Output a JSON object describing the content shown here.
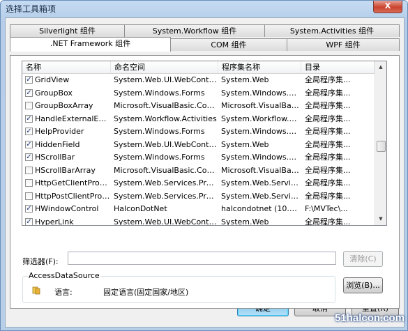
{
  "window": {
    "title": "选择工具箱项",
    "close_glyph": "X"
  },
  "tabs": {
    "row1": [
      {
        "label": "Silverlight 组件"
      },
      {
        "label": "System.Workflow 组件"
      },
      {
        "label": "System.Activities 组件"
      }
    ],
    "row2": [
      {
        "label": ".NET Framework 组件",
        "active": true
      },
      {
        "label": "COM 组件"
      },
      {
        "label": "WPF 组件"
      }
    ]
  },
  "list": {
    "columns": [
      "名称",
      "命名空间",
      "程序集名称",
      "目录"
    ],
    "check_glyph": "✓",
    "rows": [
      {
        "checked": true,
        "name": "GridView",
        "namespace": "System.Web.UI.WebContr...",
        "assembly": "System.Web",
        "directory": "全局程序集..."
      },
      {
        "checked": true,
        "name": "GroupBox",
        "namespace": "System.Windows.Forms",
        "assembly": "System.Windows.Fo...",
        "directory": "全局程序集..."
      },
      {
        "checked": false,
        "name": "GroupBoxArray",
        "namespace": "Microsoft.VisualBasic.Com...",
        "assembly": "Microsoft.VisualBas...",
        "directory": "全局程序集..."
      },
      {
        "checked": true,
        "name": "HandleExternalEvent",
        "namespace": "System.Workflow.Activities",
        "assembly": "System.Workflow.A...",
        "directory": "全局程序集..."
      },
      {
        "checked": true,
        "name": "HelpProvider",
        "namespace": "System.Windows.Forms",
        "assembly": "System.Windows.Fo...",
        "directory": "全局程序集..."
      },
      {
        "checked": true,
        "name": "HiddenField",
        "namespace": "System.Web.UI.WebContr...",
        "assembly": "System.Web",
        "directory": "全局程序集..."
      },
      {
        "checked": true,
        "name": "HScrollBar",
        "namespace": "System.Windows.Forms",
        "assembly": "System.Windows.Fo...",
        "directory": "全局程序集..."
      },
      {
        "checked": false,
        "name": "HScrollBarArray",
        "namespace": "Microsoft.VisualBasic.Com...",
        "assembly": "Microsoft.VisualBas...",
        "directory": "全局程序集..."
      },
      {
        "checked": false,
        "name": "HttpGetClientProto...",
        "namespace": "System.Web.Services.Prot...",
        "assembly": "System.Web.Services",
        "directory": "全局程序集..."
      },
      {
        "checked": false,
        "name": "HttpPostClientProt...",
        "namespace": "System.Web.Services.Prot...",
        "assembly": "System.Web.Services",
        "directory": "全局程序集..."
      },
      {
        "checked": true,
        "name": "HWindowControl",
        "namespace": "HalconDotNet",
        "assembly": "halcondotnet (10.0....",
        "directory": "F:\\MVTec\\..."
      },
      {
        "checked": true,
        "name": "HyperLink",
        "namespace": "System.Web.UI.WebContr...",
        "assembly": "System.Web",
        "directory": "全局程序集..."
      }
    ]
  },
  "filter": {
    "label": "筛选器(F):",
    "value": "",
    "clear_label": "清除(C)"
  },
  "details": {
    "title": "AccessDataSource",
    "language_label": "语言:",
    "language_value": "固定语言(固定国家/地区)",
    "browse_label": "浏览(B)..."
  },
  "buttons": {
    "ok_label": "确定",
    "cancel_label": "取消",
    "reset_label": "重置(R)"
  },
  "watermark": "51halcon.com"
}
